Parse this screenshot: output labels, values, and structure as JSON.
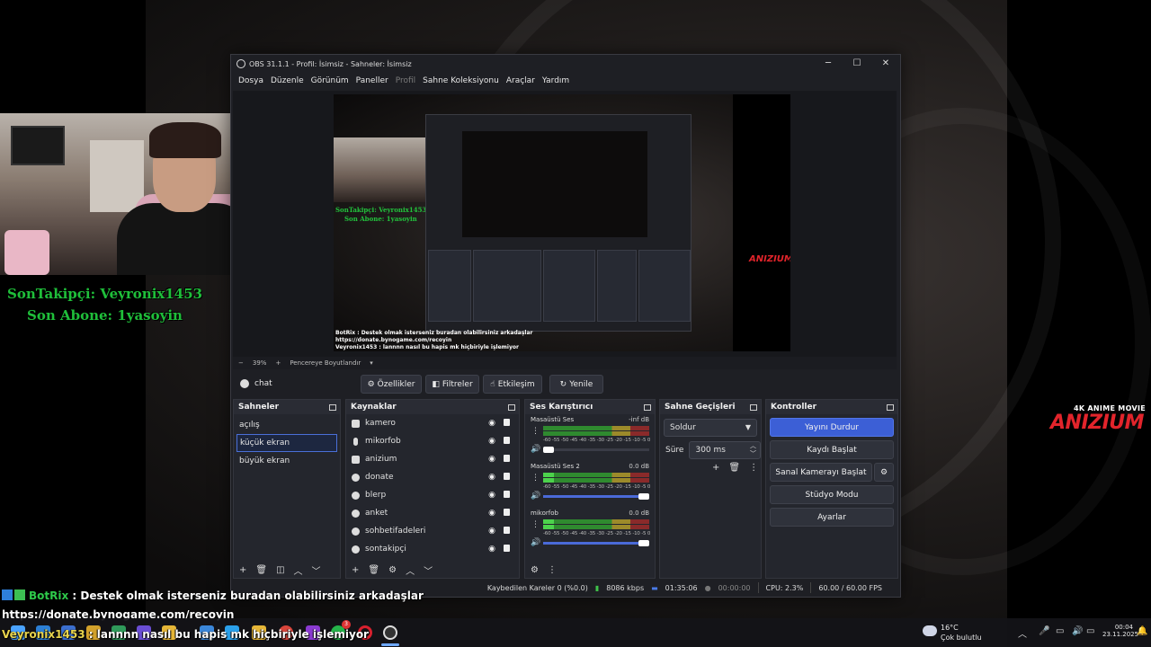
{
  "overlay": {
    "son_takipci": "SonTakipçi: Veyronix1453",
    "son_abone": "Son Abone: 1yasoyin",
    "logo_small": "4K ANIME MOVIE",
    "logo_big": "ANIZIUM"
  },
  "chat": [
    {
      "user": "BotRix",
      "text": ": Destek olmak isterseniz buradan olabilirsiniz arkadaşlar"
    },
    {
      "user": "",
      "text": "https://donate.bynogame.com/recoyin"
    },
    {
      "user": "Veyronix1453",
      "text": ": lannnn nasıl bu hapis mk hiçbiriyle işlemiyor"
    }
  ],
  "obs": {
    "title": "OBS 31.1.1 - Profil: İsimsiz - Sahneler: İsimsiz",
    "window_controls": [
      "─",
      "☐",
      "✕"
    ],
    "menu": [
      "Dosya",
      "Düzenle",
      "Görünüm",
      "Paneller",
      "Profil",
      "Sahne Koleksiyonu",
      "Araçlar",
      "Yardım"
    ],
    "zoom": {
      "minus": "−",
      "value": "39%",
      "plus": "+",
      "fit": "Pencereye Boyutlandır",
      "chev": "▾"
    },
    "current_source": "chat",
    "source_buttons": [
      "Özellikler",
      "Filtreler",
      "Etkileşim",
      "Yenile"
    ],
    "preview_text": {
      "son_takipci": "SonTakipçi: Veyronix1453",
      "son_abone": "Son Abone: 1yasoyin",
      "chat1": "BotRix : Destek olmak isterseniz buradan olabilirsiniz arkadaşlar",
      "chat2": "https://donate.bynogame.com/recoyin",
      "chat3": "Veyronix1453 : lannnn nasıl bu hapis mk hiçbiriyle işlemiyor",
      "logo": "ANIZIUM"
    },
    "scenes": {
      "title": "Sahneler",
      "items": [
        "açılış",
        "küçük ekran",
        "büyük ekran"
      ],
      "selected": 1
    },
    "sources": {
      "title": "Kaynaklar",
      "items": [
        "kamero",
        "mikorfob",
        "anizium",
        "donate",
        "blerp",
        "anket",
        "sohbetifadeleri",
        "sontakipçi"
      ]
    },
    "mixer": {
      "title": "Ses Karıştırıcı",
      "channels": [
        {
          "name": "Masaüstü Ses",
          "db": "-inf dB",
          "muted_level": true
        },
        {
          "name": "Masaüstü Ses 2",
          "db": "0.0 dB",
          "muted_level": false
        },
        {
          "name": "mikorfob",
          "db": "0.0 dB",
          "muted_level": false
        }
      ],
      "scale": "-60 -55 -50 -45 -40 -35 -30 -25 -20 -15 -10 -5  0"
    },
    "transitions": {
      "title": "Sahne Geçişleri",
      "selected": "Soldur",
      "duration_label": "Süre",
      "duration": "300 ms"
    },
    "controls": {
      "title": "Kontroller",
      "buttons": [
        "Yayını Durdur",
        "Kaydı Başlat",
        "Sanal Kamerayı Başlat",
        "Stüdyo Modu",
        "Ayarlar"
      ]
    },
    "status": {
      "dropped": "Kaybedilen Kareler 0 (%0.0)",
      "bitrate": "8086 kbps",
      "stream_time": "01:35:06",
      "rec_time": "00:00:00",
      "cpu": "CPU: 2.3%",
      "fps": "60.00 / 60.00 FPS"
    }
  },
  "taskbar": {
    "weather_temp": "16°C",
    "weather_desc": "Çok bulutlu",
    "time": "00:04",
    "date": "23.11.2025",
    "notif_badge": "3"
  }
}
